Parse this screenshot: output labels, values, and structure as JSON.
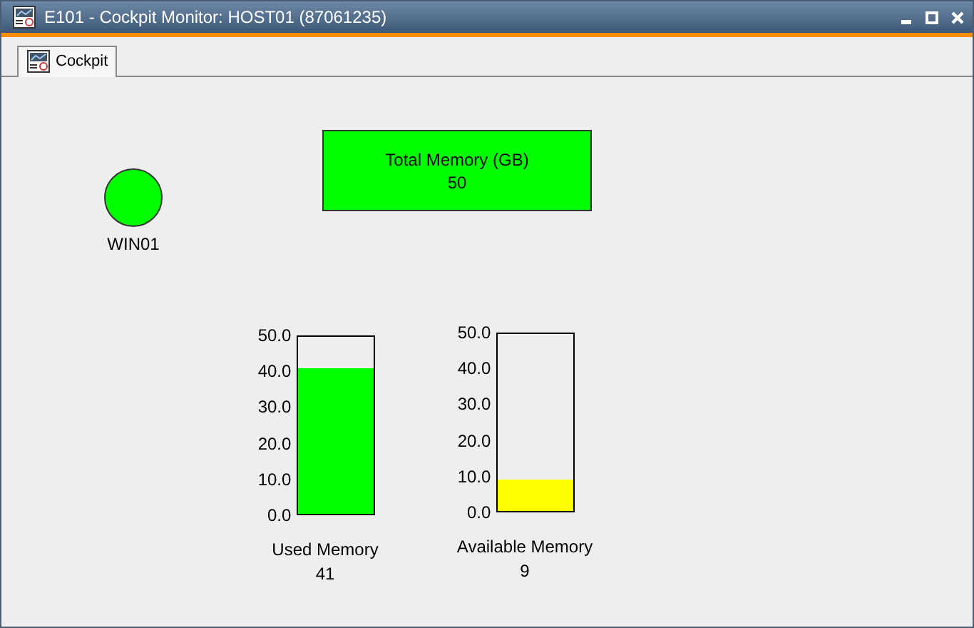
{
  "window": {
    "title": "E101 - Cockpit Monitor: HOST01 (87061235)",
    "controls": [
      {
        "kind": "minimize"
      },
      {
        "kind": "maximize"
      },
      {
        "kind": "close"
      }
    ]
  },
  "tabs": [
    {
      "label": "Cockpit",
      "selected": true
    }
  ],
  "host": {
    "name": "WIN01",
    "color": "#00ff00"
  },
  "total": {
    "label": "Total Memory (GB)",
    "value": "50",
    "color": "#00ff00"
  },
  "gauges": [
    {
      "label": "Used Memory",
      "value": "41",
      "level": 0.82,
      "color": "#00ff00",
      "ticks": [
        "50.0",
        "40.0",
        "30.0",
        "20.0",
        "10.0",
        "0.0"
      ]
    },
    {
      "label": "Available Memory",
      "value": "9",
      "level": 0.18,
      "color": "#ffff00",
      "ticks": [
        "50.0",
        "40.0",
        "30.0",
        "20.0",
        "10.0",
        "0.0"
      ]
    }
  ]
}
